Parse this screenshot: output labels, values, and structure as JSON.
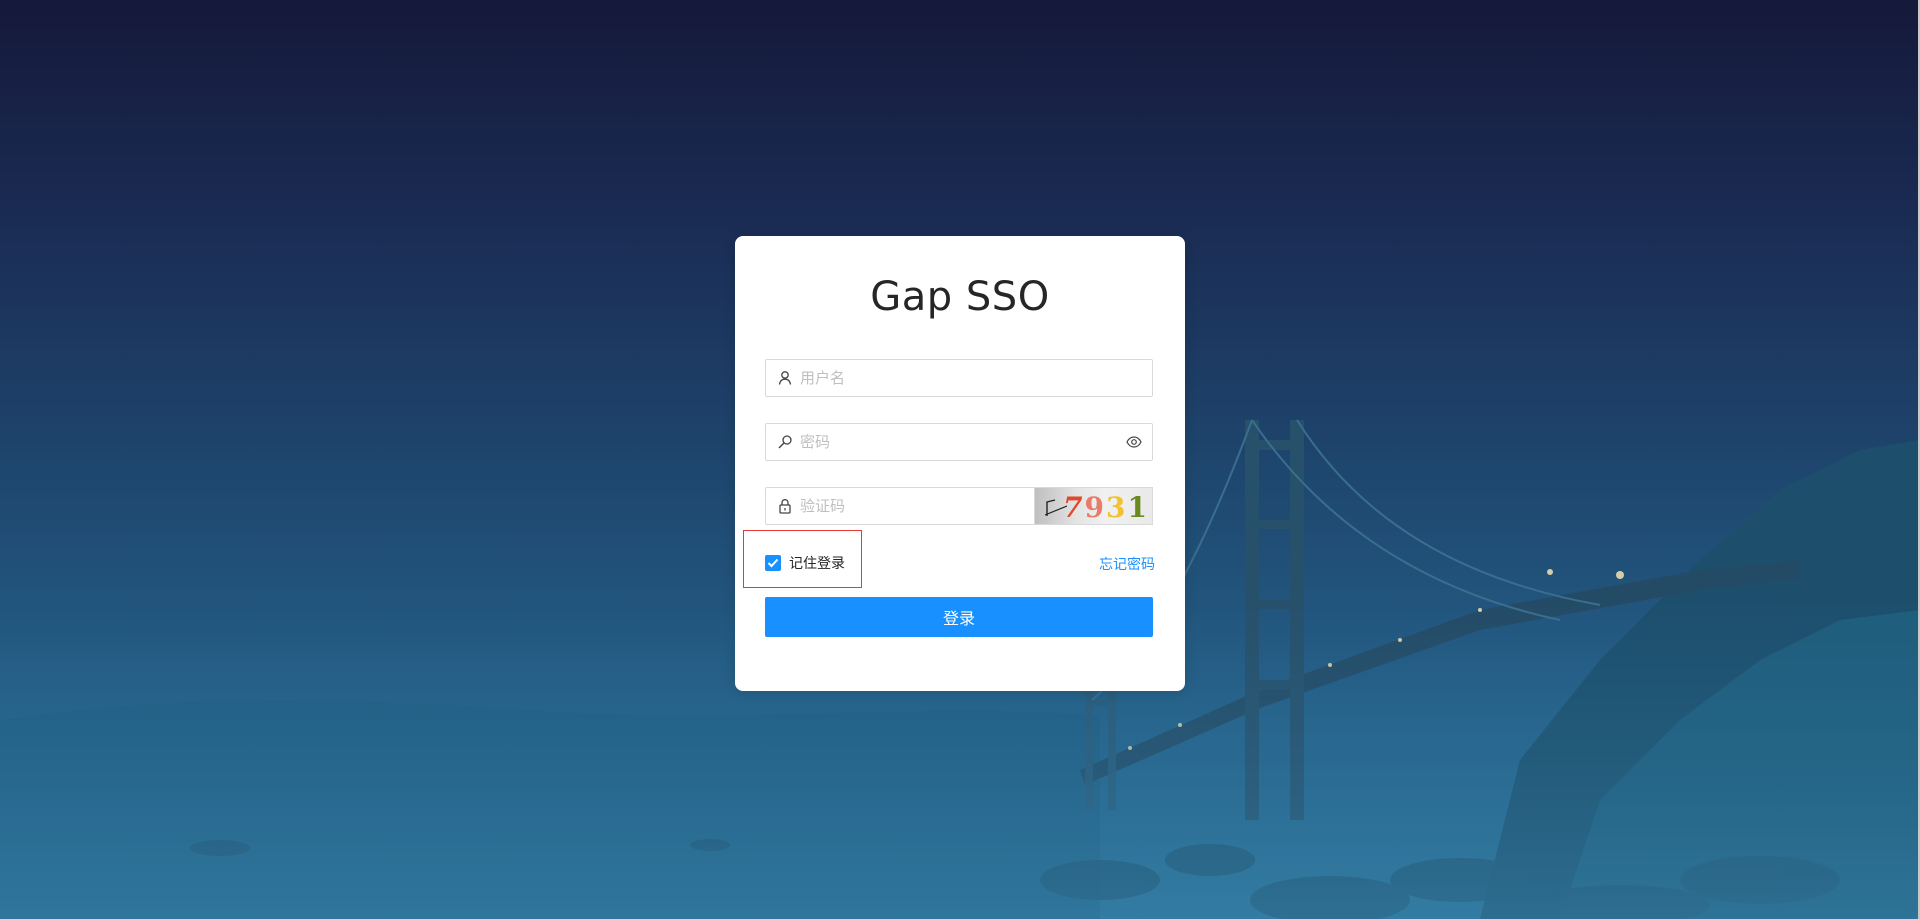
{
  "login": {
    "title": "Gap SSO",
    "username": {
      "placeholder": "用户名",
      "value": ""
    },
    "password": {
      "placeholder": "密码",
      "value": ""
    },
    "captcha": {
      "placeholder": "验证码",
      "value": "",
      "image_text": [
        "7",
        "9",
        "3",
        "1"
      ]
    },
    "remember": {
      "label": "记住登录",
      "checked": true
    },
    "forgot_label": "忘记密码",
    "submit_label": "登录"
  },
  "icons": {
    "username": "user-icon",
    "password": "key-icon",
    "visibility": "eye-icon",
    "captcha": "lock-icon",
    "checkbox": "checkmark-icon"
  },
  "colors": {
    "primary": "#1890ff",
    "highlight_border": "#e53935",
    "card": "#ffffff"
  }
}
